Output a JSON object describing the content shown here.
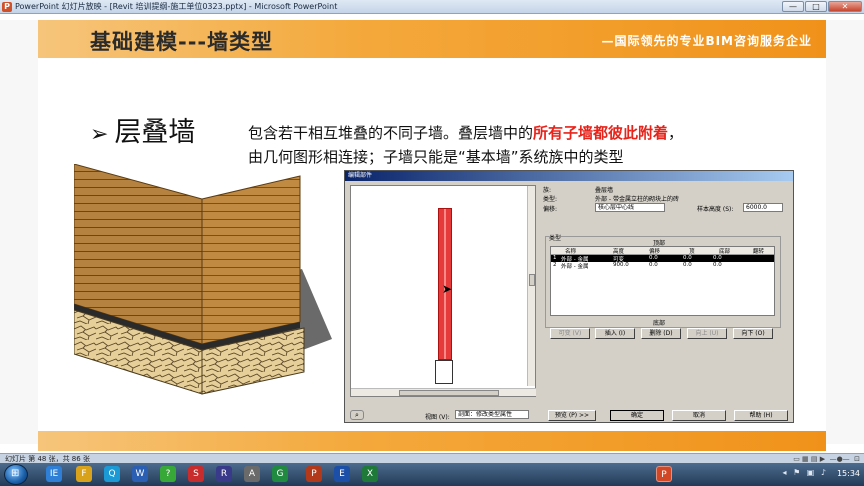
{
  "window": {
    "title": "PowerPoint 幻灯片放映 - [Revit 培训提纲-施工单位0323.pptx] - Microsoft PowerPoint",
    "buttons": [
      "—",
      "□",
      "✕"
    ]
  },
  "slide": {
    "title": "基础建模---墙类型",
    "slogan": "—国际领先的专业BIM咨询服务企业",
    "bullet": "层叠墙",
    "body_line1_pre": "包含若干相互堆叠的不同子墙。叠层墙中的",
    "body_line1_red": "所有子墙都彼此附着",
    "body_line1_post": "，",
    "body_line2": "由几何图形相连接；子墙只能是“基本墙”系统族中的类型"
  },
  "dialog": {
    "title": "编辑部件",
    "family_label": "族:",
    "family_value": "叠层墙",
    "type_label": "类型:",
    "type_value": "外部 - 带金属立柱的砌块上的砖",
    "offset_label": "偏移:",
    "offset_value": "核心层中心线",
    "sample_height_label": "样本高度 (S):",
    "sample_height_value": "6000.0",
    "types_group_label": "类型",
    "top_label": "顶部",
    "bottom_label": "底部",
    "columns": [
      "名称",
      "高度",
      "偏移",
      "顶",
      "底部",
      "翻转"
    ],
    "rows": [
      {
        "no": "1",
        "name": "外部 - 金属",
        "height": "可变",
        "offset": "0.0",
        "top": "0.0",
        "bottom": "0.0"
      },
      {
        "no": "2",
        "name": "外部 - 金属",
        "height": "900.0",
        "offset": "0.0",
        "top": "0.0",
        "bottom": "0.0"
      }
    ],
    "buttons": {
      "variable": "可变 (V)",
      "insert": "插入 (I)",
      "delete": "删除 (D)",
      "up": "向上 (U)",
      "down": "向下 (O)",
      "preview": "预览 (P) >>",
      "ok": "确定",
      "cancel": "取消",
      "help": "帮助 (H)"
    },
    "view_label": "视图 (V):",
    "view_value": "剖面：修改类型属性"
  },
  "statusbar": {
    "text": "幻灯片 第 48 张，共 86 张"
  },
  "taskbar": {
    "clock": "15:34",
    "items": [
      "IE",
      "F",
      "Q",
      "W",
      "?",
      "S",
      "R",
      "A",
      "G",
      "P",
      "E",
      "X",
      "P"
    ]
  }
}
